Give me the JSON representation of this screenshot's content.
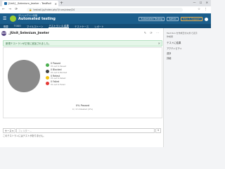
{
  "browser": {
    "tab_title": "[Unit] _Selenium_Jmeter - TestRail",
    "tab_close": "×",
    "new_tab": "+",
    "window_controls": "— ☐ ✕",
    "url": "testrail.jp/index.php?/runs/view/24",
    "nav_glyphs": "← → ⟳",
    "extra_glyphs": "☆ ⋮"
  },
  "app": {
    "brand_small": "グリッドテスト管理",
    "title": "Automated testing",
    "header_select_1": "Automated Testing",
    "header_select_2": "Admin",
    "header_select_3": "Help & Support",
    "nav": [
      "概要",
      "TODO",
      "マイルストーン",
      "テストラン & 結果",
      "テストケース",
      "レポート"
    ]
  },
  "run": {
    "avatar_text": "R24",
    "title": "_JUnit_Selenium_Jmeter",
    "icons": "✎ ⟳ ⋯",
    "alert_message": "新規テストランが正常に追加されました。",
    "alert_close": "×",
    "legend": [
      {
        "label": "0 Passed",
        "sub": "0% set to Passed",
        "color": "#4caf50"
      },
      {
        "label": "0 Blocked",
        "sub": "0% set to Blocked",
        "color": "#424242"
      },
      {
        "label": "0 Retest",
        "sub": "0% set to Retest",
        "color": "#f4c20d"
      },
      {
        "label": "0 Failed",
        "sub": "0% set to Failed",
        "color": "#e53935"
      }
    ],
    "pie_color": "#8a8a8a",
    "passed_pct": "0% Passed",
    "untested": "0 / 0 Untested (0%)",
    "filter_select": "ケース ▾",
    "filter_placeholder": "フィルター...",
    "filter_button": "▾",
    "no_results": "このテストランにはテストがありません。"
  },
  "sidebar": {
    "line1": "Test Run を作成日付以外で表示",
    "line2": "作成者",
    "section": "テストに結果",
    "items": [
      "アクティビティ",
      "進捗",
      "詳細"
    ]
  }
}
